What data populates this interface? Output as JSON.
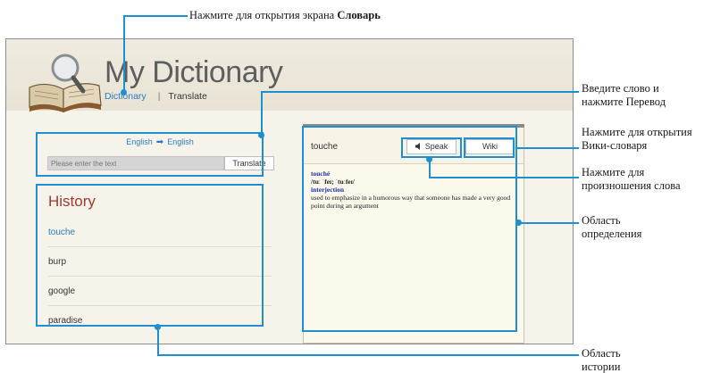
{
  "callouts": {
    "dictionary_prefix": "Нажмите для открытия экрана ",
    "dictionary_bold": "Словарь",
    "translate_line1": "Введите слово и",
    "translate_line2": "нажмите Перевод",
    "wiki_line1": "Нажмите для открытия",
    "wiki_line2": "Вики-словаря",
    "speak_line1": "Нажмите для",
    "speak_line2": "произношения слова",
    "definition_line1": "Область",
    "definition_line2": "определения",
    "history_line1": "Область",
    "history_line2": "истории"
  },
  "app": {
    "title": "My Dictionary",
    "nav": {
      "dictionary": "Dictionary",
      "separator": "|",
      "translate": "Translate"
    }
  },
  "search": {
    "lang_from": "English",
    "lang_to": "English",
    "placeholder": "Please enter the text",
    "translate_label": "Translate"
  },
  "history": {
    "title": "History",
    "items": [
      "touche",
      "burp",
      "google",
      "paradise"
    ]
  },
  "definition": {
    "word": "touche",
    "speak_label": "Speak",
    "wiki_label": "Wiki",
    "headword": "touché",
    "pronunciation": "/tuː ˈfeɪ; ˈtuːfeɪ/",
    "part_of_speech": "interjection",
    "text": "used to emphasize in a humorous way that someone has made a very good point during an argument"
  },
  "colors": {
    "accent_blue": "#2b7bc2",
    "history_title": "#a13b33",
    "callout_blue": "#1e8fd0"
  }
}
